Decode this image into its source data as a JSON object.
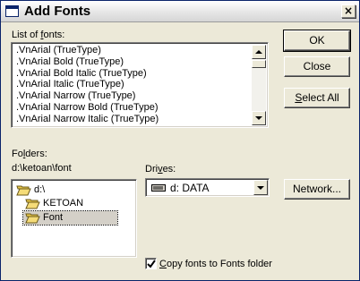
{
  "window": {
    "title": "Add Fonts",
    "close_glyph": "×"
  },
  "font_list": {
    "label_before": "List of ",
    "label_mnemonic": "f",
    "label_after": "onts:",
    "items": [
      ".VnArial (TrueType)",
      ".VnArial Bold (TrueType)",
      ".VnArial Bold Italic (TrueType)",
      ".VnArial Italic (TrueType)",
      ".VnArial Narrow (TrueType)",
      ".VnArial Narrow Bold (TrueType)",
      ".VnArial Narrow Italic (TrueType)"
    ]
  },
  "buttons": {
    "ok": "OK",
    "close": "Close",
    "select_all_mnemonic": "S",
    "select_all_rest": "elect All",
    "network": "Network..."
  },
  "folders": {
    "label_before": "Fo",
    "label_mnemonic": "l",
    "label_after": "ders:",
    "current_path": "d:\\ketoan\\font",
    "tree": [
      "d:\\",
      "KETOAN",
      "Font"
    ]
  },
  "drives": {
    "label_before": "Dri",
    "label_mnemonic": "v",
    "label_after": "es:",
    "selected": "d: DATA"
  },
  "copy_option": {
    "checked": true,
    "label_mnemonic": "C",
    "label_rest": "opy fonts to Fonts folder"
  },
  "colors": {
    "dialog_bg": "#ece9d8",
    "folder_yellow": "#e8c84a",
    "selection_bg": "#d4d0c8"
  }
}
